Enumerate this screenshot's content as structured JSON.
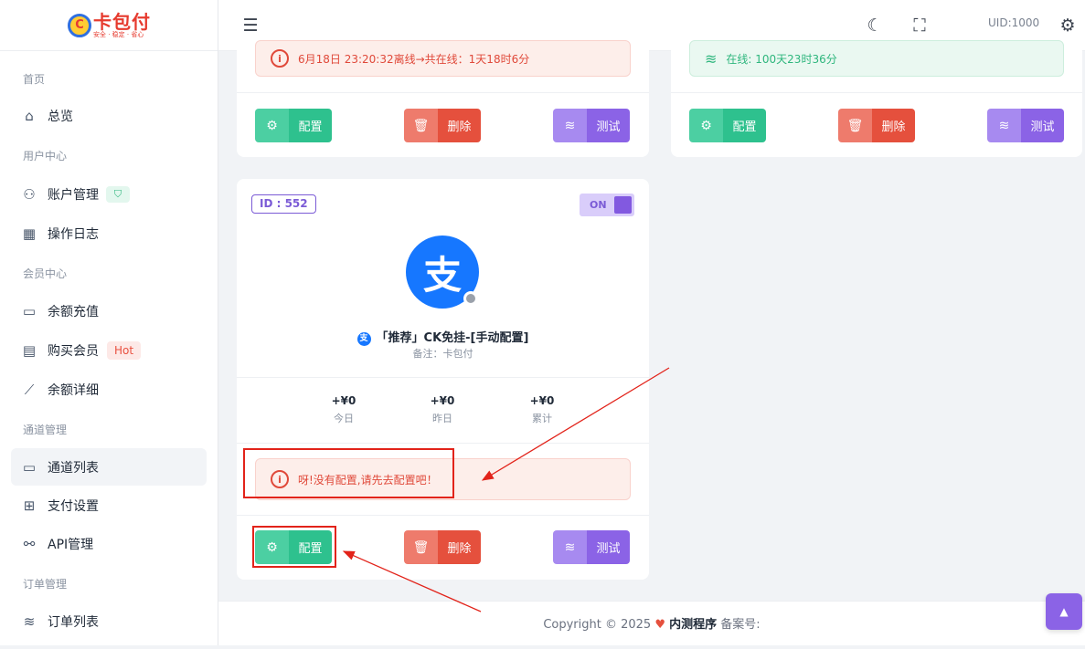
{
  "app": {
    "logo_title": "卡包付",
    "logo_subtitle": "安全 · 稳定 · 省心",
    "logo_glyph": "C"
  },
  "sidebar": {
    "sections": [
      {
        "label": "首页"
      },
      {
        "label": "用户中心"
      },
      {
        "label": "会员中心"
      },
      {
        "label": "通道管理"
      },
      {
        "label": "订单管理"
      }
    ],
    "items": [
      {
        "label": "总览",
        "icon": "home-icon"
      },
      {
        "label": "账户管理",
        "icon": "user-icon"
      },
      {
        "label": "操作日志",
        "icon": "calendar-icon"
      },
      {
        "label": "余额充值",
        "icon": "wallet-icon"
      },
      {
        "label": "购买会员",
        "icon": "store-icon",
        "badge": "Hot"
      },
      {
        "label": "余额详细",
        "icon": "chart-line-icon"
      },
      {
        "label": "通道列表",
        "icon": "drive-icon",
        "active": true
      },
      {
        "label": "支付设置",
        "icon": "grid-icon"
      },
      {
        "label": "API管理",
        "icon": "nodes-icon"
      },
      {
        "label": "订单列表",
        "icon": "layers-icon"
      }
    ]
  },
  "header": {
    "uid": "UID:1000"
  },
  "cards": {
    "top_left": {
      "alert": "6月18日 23:20:32离线→共在线：1天18时6分"
    },
    "top_right": {
      "alert": "在线: 100天23时36分"
    },
    "main": {
      "id": "ID : 552",
      "toggle": "ON",
      "pay_glyph": "支",
      "name": "「推荐」CK免挂-[手动配置]",
      "remark": "备注：卡包付",
      "stats": [
        {
          "value": "+¥0",
          "label": "今日"
        },
        {
          "value": "+¥0",
          "label": "昨日"
        },
        {
          "value": "+¥0",
          "label": "累计"
        }
      ],
      "alert": "呀!没有配置,请先去配置吧！"
    }
  },
  "buttons": {
    "config": "配置",
    "delete": "删除",
    "test": "测试"
  },
  "footer": {
    "copyright": "Copyright © 2025",
    "brand": "内测程序",
    "icp": "备案号:"
  },
  "colors": {
    "accent": "#8b63e6",
    "success": "#2ec18e",
    "danger": "#e5503d",
    "annotation": "#e2231a"
  }
}
